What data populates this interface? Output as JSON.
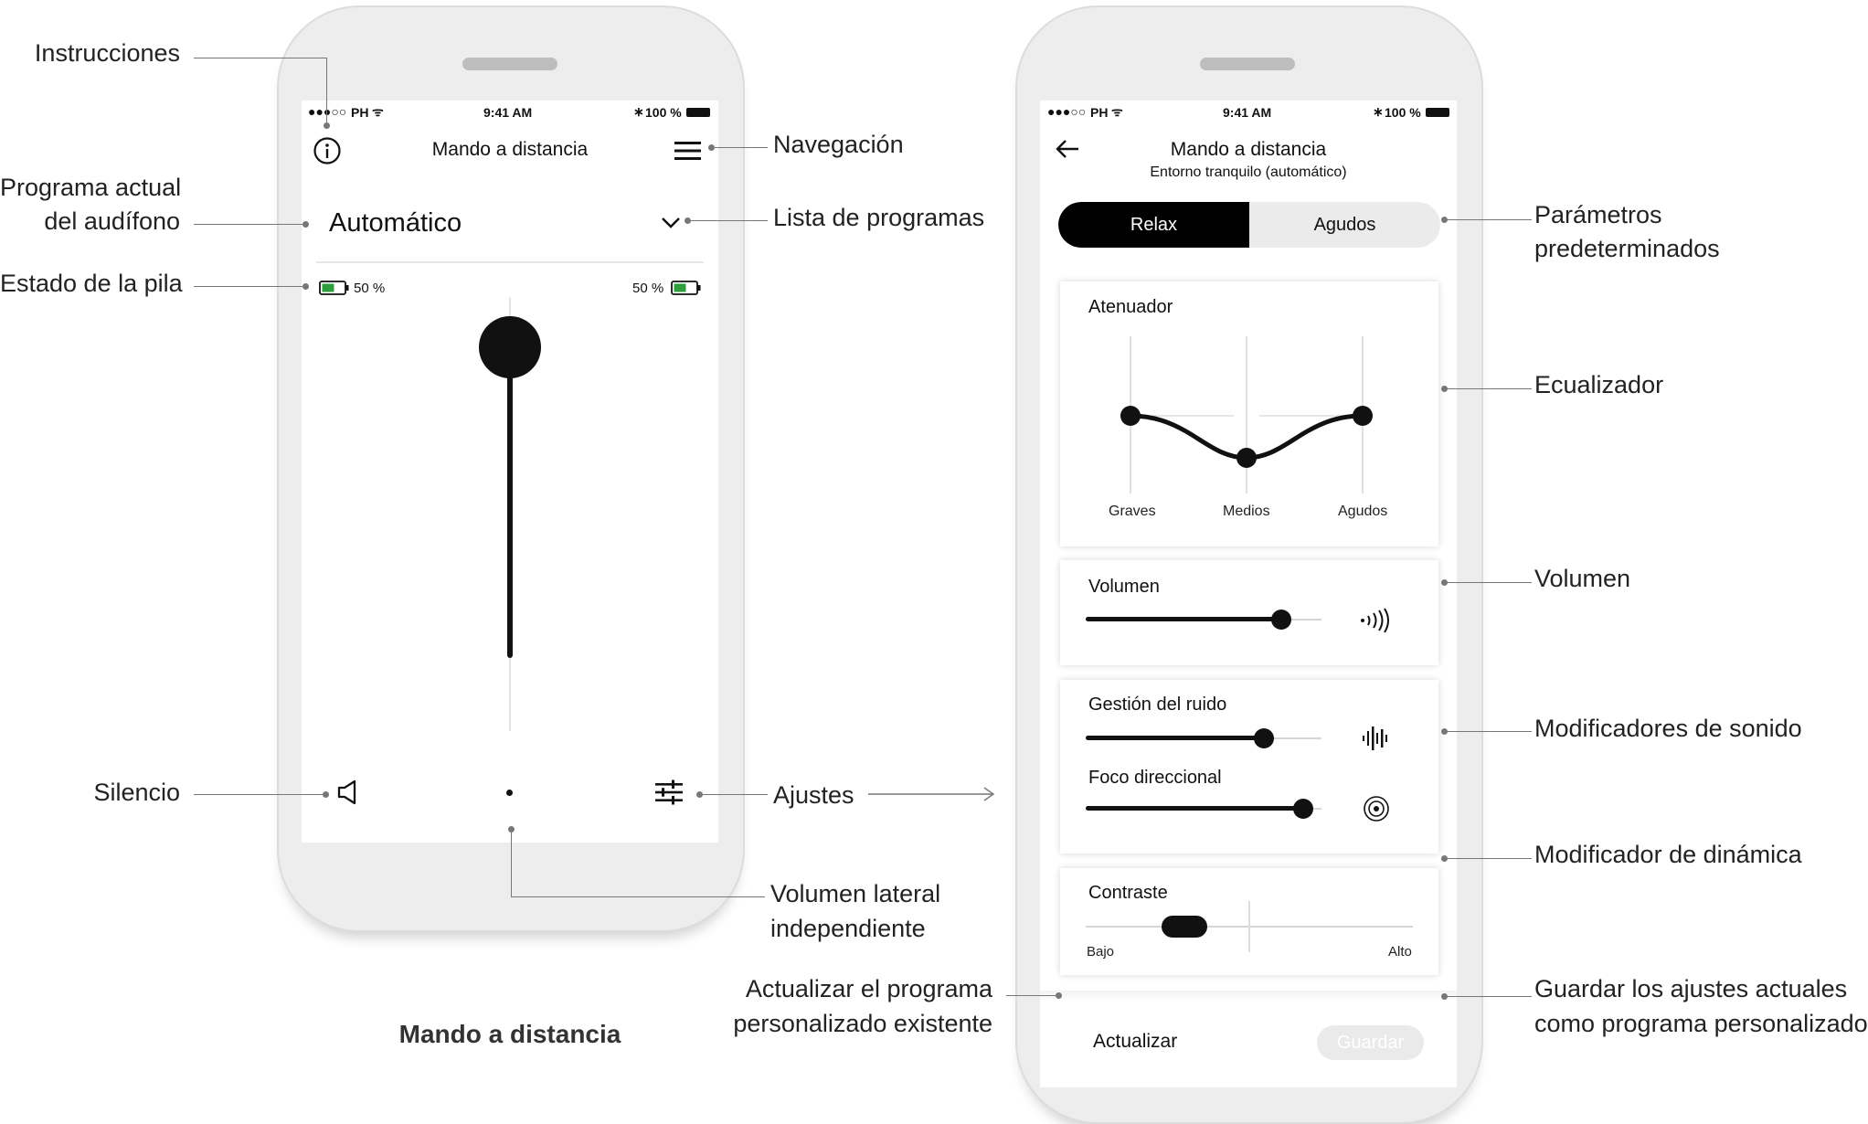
{
  "caption": "Mando a distancia",
  "left_phone": {
    "status": {
      "carrier": "PH",
      "time": "9:41 AM",
      "battery": "100 %"
    },
    "title": "Mando a distancia",
    "program": "Automático",
    "battery_left": "50 %",
    "battery_right": "50 %",
    "volume_level": 0.78
  },
  "right_phone": {
    "status": {
      "carrier": "PH",
      "time": "9:41 AM",
      "battery": "100 %"
    },
    "title": "Mando a distancia",
    "subtitle": "Entorno tranquilo (automático)",
    "segments": [
      "Relax",
      "Agudos"
    ],
    "equalizer": {
      "title": "Atenuador",
      "bands": [
        "Graves",
        "Medios",
        "Agudos"
      ]
    },
    "volume": {
      "title": "Volumen",
      "level": 0.86
    },
    "noise": {
      "title": "Gestión del ruido",
      "level": 0.78
    },
    "focus": {
      "title": "Foco direccional",
      "level": 0.96
    },
    "contrast": {
      "title": "Contraste",
      "low": "Bajo",
      "high": "Alto",
      "level": 0.27
    },
    "update_label": "Actualizar",
    "save_label": "Guardar"
  },
  "annotations": {
    "instrucciones": "Instrucciones",
    "programa_1": "Programa actual",
    "programa_2": "del audífono",
    "pila": "Estado de la pila",
    "silencio": "Silencio",
    "navegacion": "Navegación",
    "lista": "Lista de programas",
    "ajustes": "Ajustes",
    "vol_lateral_1": "Volumen lateral",
    "vol_lateral_2": "independiente",
    "actualizar_1": "Actualizar el programa",
    "actualizar_2": "personalizado existente",
    "parametros_1": "Parámetros",
    "parametros_2": "predeterminados",
    "ecualizador": "Ecualizador",
    "volumen": "Volumen",
    "modificadores": "Modificadores de sonido",
    "dinamica": "Modificador de dinámica",
    "guardar_1": "Guardar los ajustes actuales",
    "guardar_2": "como programa personalizado"
  }
}
